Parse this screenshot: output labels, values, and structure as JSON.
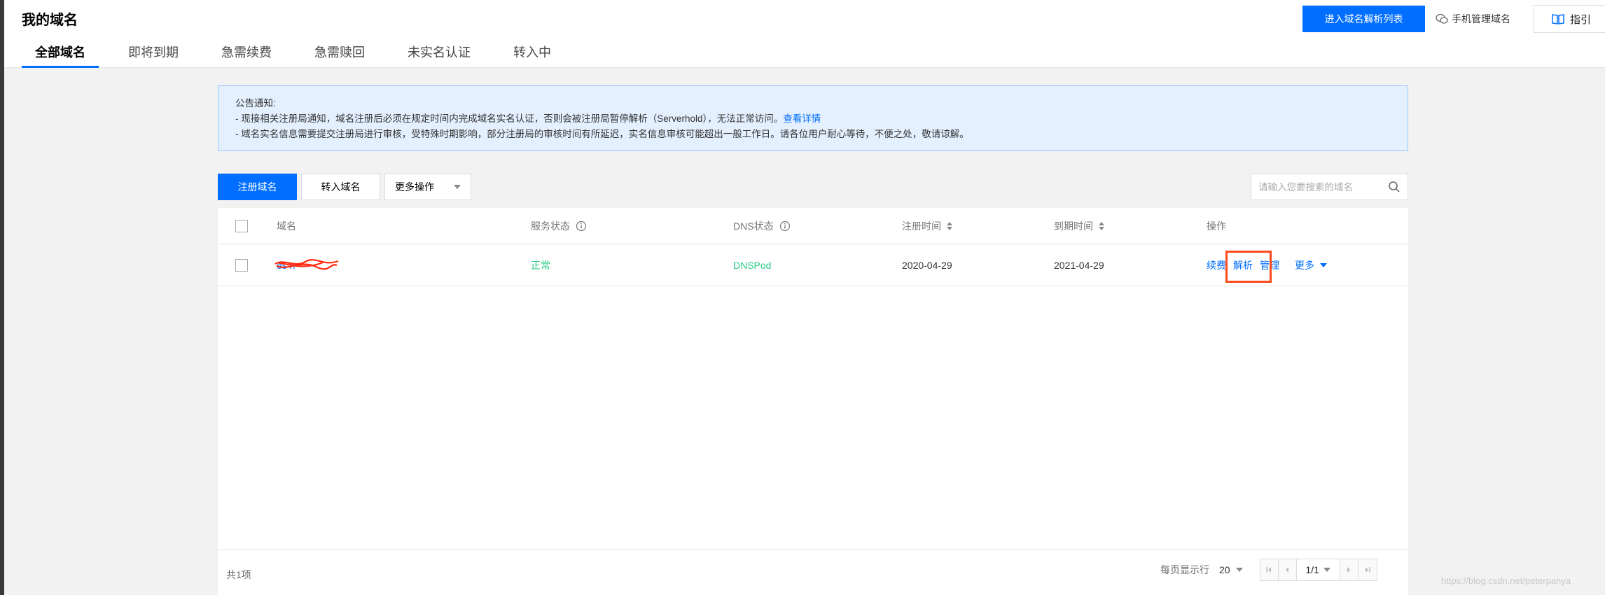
{
  "header": {
    "title": "我的域名",
    "tabs": [
      {
        "label": "全部域名",
        "active": true
      },
      {
        "label": "即将到期",
        "active": false
      },
      {
        "label": "急需续费",
        "active": false
      },
      {
        "label": "急需赎回",
        "active": false
      },
      {
        "label": "未实名认证",
        "active": false
      },
      {
        "label": "转入中",
        "active": false
      }
    ],
    "dns_list_button": "进入域名解析列表",
    "mobile_manage": "手机管理域名",
    "guide": "指引"
  },
  "notice": {
    "title": "公告通知:",
    "line1": "- 现接相关注册局通知，域名注册后必须在规定时间内完成域名实名认证，否则会被注册局暂停解析（Serverhold），无法正常访问。",
    "line1_link": "查看详情",
    "line2": "- 域名实名信息需要提交注册局进行审核，受特殊时期影响，部分注册局的审核时间有所延迟，实名信息审核可能超出一般工作日。请各位用户耐心等待，不便之处，敬请谅解。"
  },
  "toolbar": {
    "register": "注册域名",
    "transfer_in": "转入域名",
    "more_actions": "更多操作",
    "search_placeholder": "请输入您要搜索的域名"
  },
  "table": {
    "columns": {
      "domain": "域名",
      "service_status": "服务状态",
      "dns_status": "DNS状态",
      "reg_time": "注册时间",
      "expire_time": "到期时间",
      "actions": "操作"
    },
    "rows": [
      {
        "domain": "es          n",
        "service_status": "正常",
        "dns_status": "DNSPod",
        "reg_time": "2020-04-29",
        "expire_time": "2021-04-29",
        "actions": {
          "renew": "续费",
          "resolve": "解析",
          "manage": "管理",
          "more": "更多"
        }
      }
    ]
  },
  "footer": {
    "total": "共1项",
    "page_size_label": "每页显示行",
    "page_size": "20",
    "page_indicator": "1/1"
  },
  "watermark": "https://blog.csdn.net/peterpanya",
  "colors": {
    "primary": "#006eff",
    "status_ok": "#29cc85",
    "highlight": "#ff4a1c",
    "notice_bg": "#e5f0ff"
  }
}
